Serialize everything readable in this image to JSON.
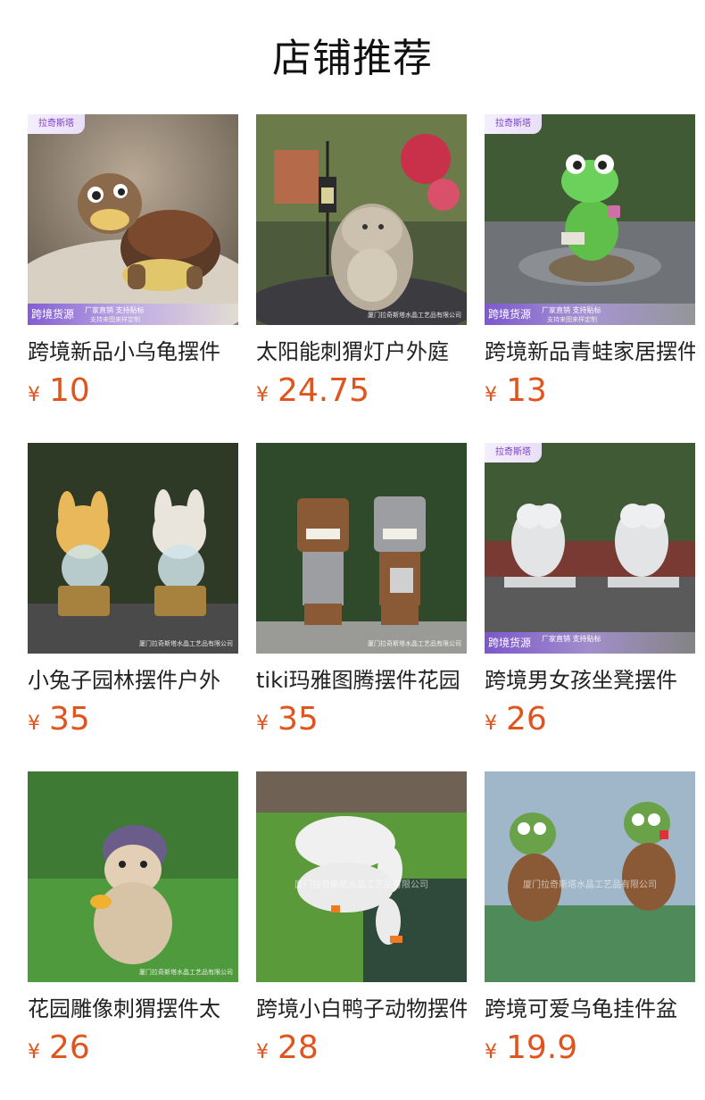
{
  "section_title": "店铺推荐",
  "colors": {
    "price": "#e0541d",
    "badge_purple": "#7e58d2",
    "text": "#222222"
  },
  "labels": {
    "brand_badge": "拉奇斯塔",
    "cross_border": "跨境货源",
    "factory_direct": "厂家直销  支持贴标",
    "custom_note": "支持来图来样定制",
    "watermark": "厦门拉奇斯塔水晶工艺品有限公司"
  },
  "products": [
    {
      "name": "跨境新品小乌龟摆件",
      "currency": "¥",
      "price": "10",
      "image": "turtle-figurine"
    },
    {
      "name": "太阳能刺猬灯户外庭",
      "currency": "¥",
      "price": "24.75",
      "image": "hedgehog-solar-lamp"
    },
    {
      "name": "跨境新品青蛙家居摆件",
      "currency": "¥",
      "price": "13",
      "image": "frog-figurine"
    },
    {
      "name": "小兔子园林摆件户外",
      "currency": "¥",
      "price": "35",
      "image": "rabbit-figurines"
    },
    {
      "name": "tiki玛雅图腾摆件花园",
      "currency": "¥",
      "price": "35",
      "image": "tiki-totems"
    },
    {
      "name": "跨境男女孩坐凳摆件",
      "currency": "¥",
      "price": "26",
      "image": "angel-children-bench"
    },
    {
      "name": "花园雕像刺猬摆件太",
      "currency": "¥",
      "price": "26",
      "image": "hedgehog-on-grass"
    },
    {
      "name": "跨境小白鸭子动物摆件",
      "currency": "¥",
      "price": "28",
      "image": "white-ducks-pond"
    },
    {
      "name": "跨境可爱乌龟挂件盆",
      "currency": "¥",
      "price": "19.9",
      "image": "hanging-turtles"
    }
  ]
}
